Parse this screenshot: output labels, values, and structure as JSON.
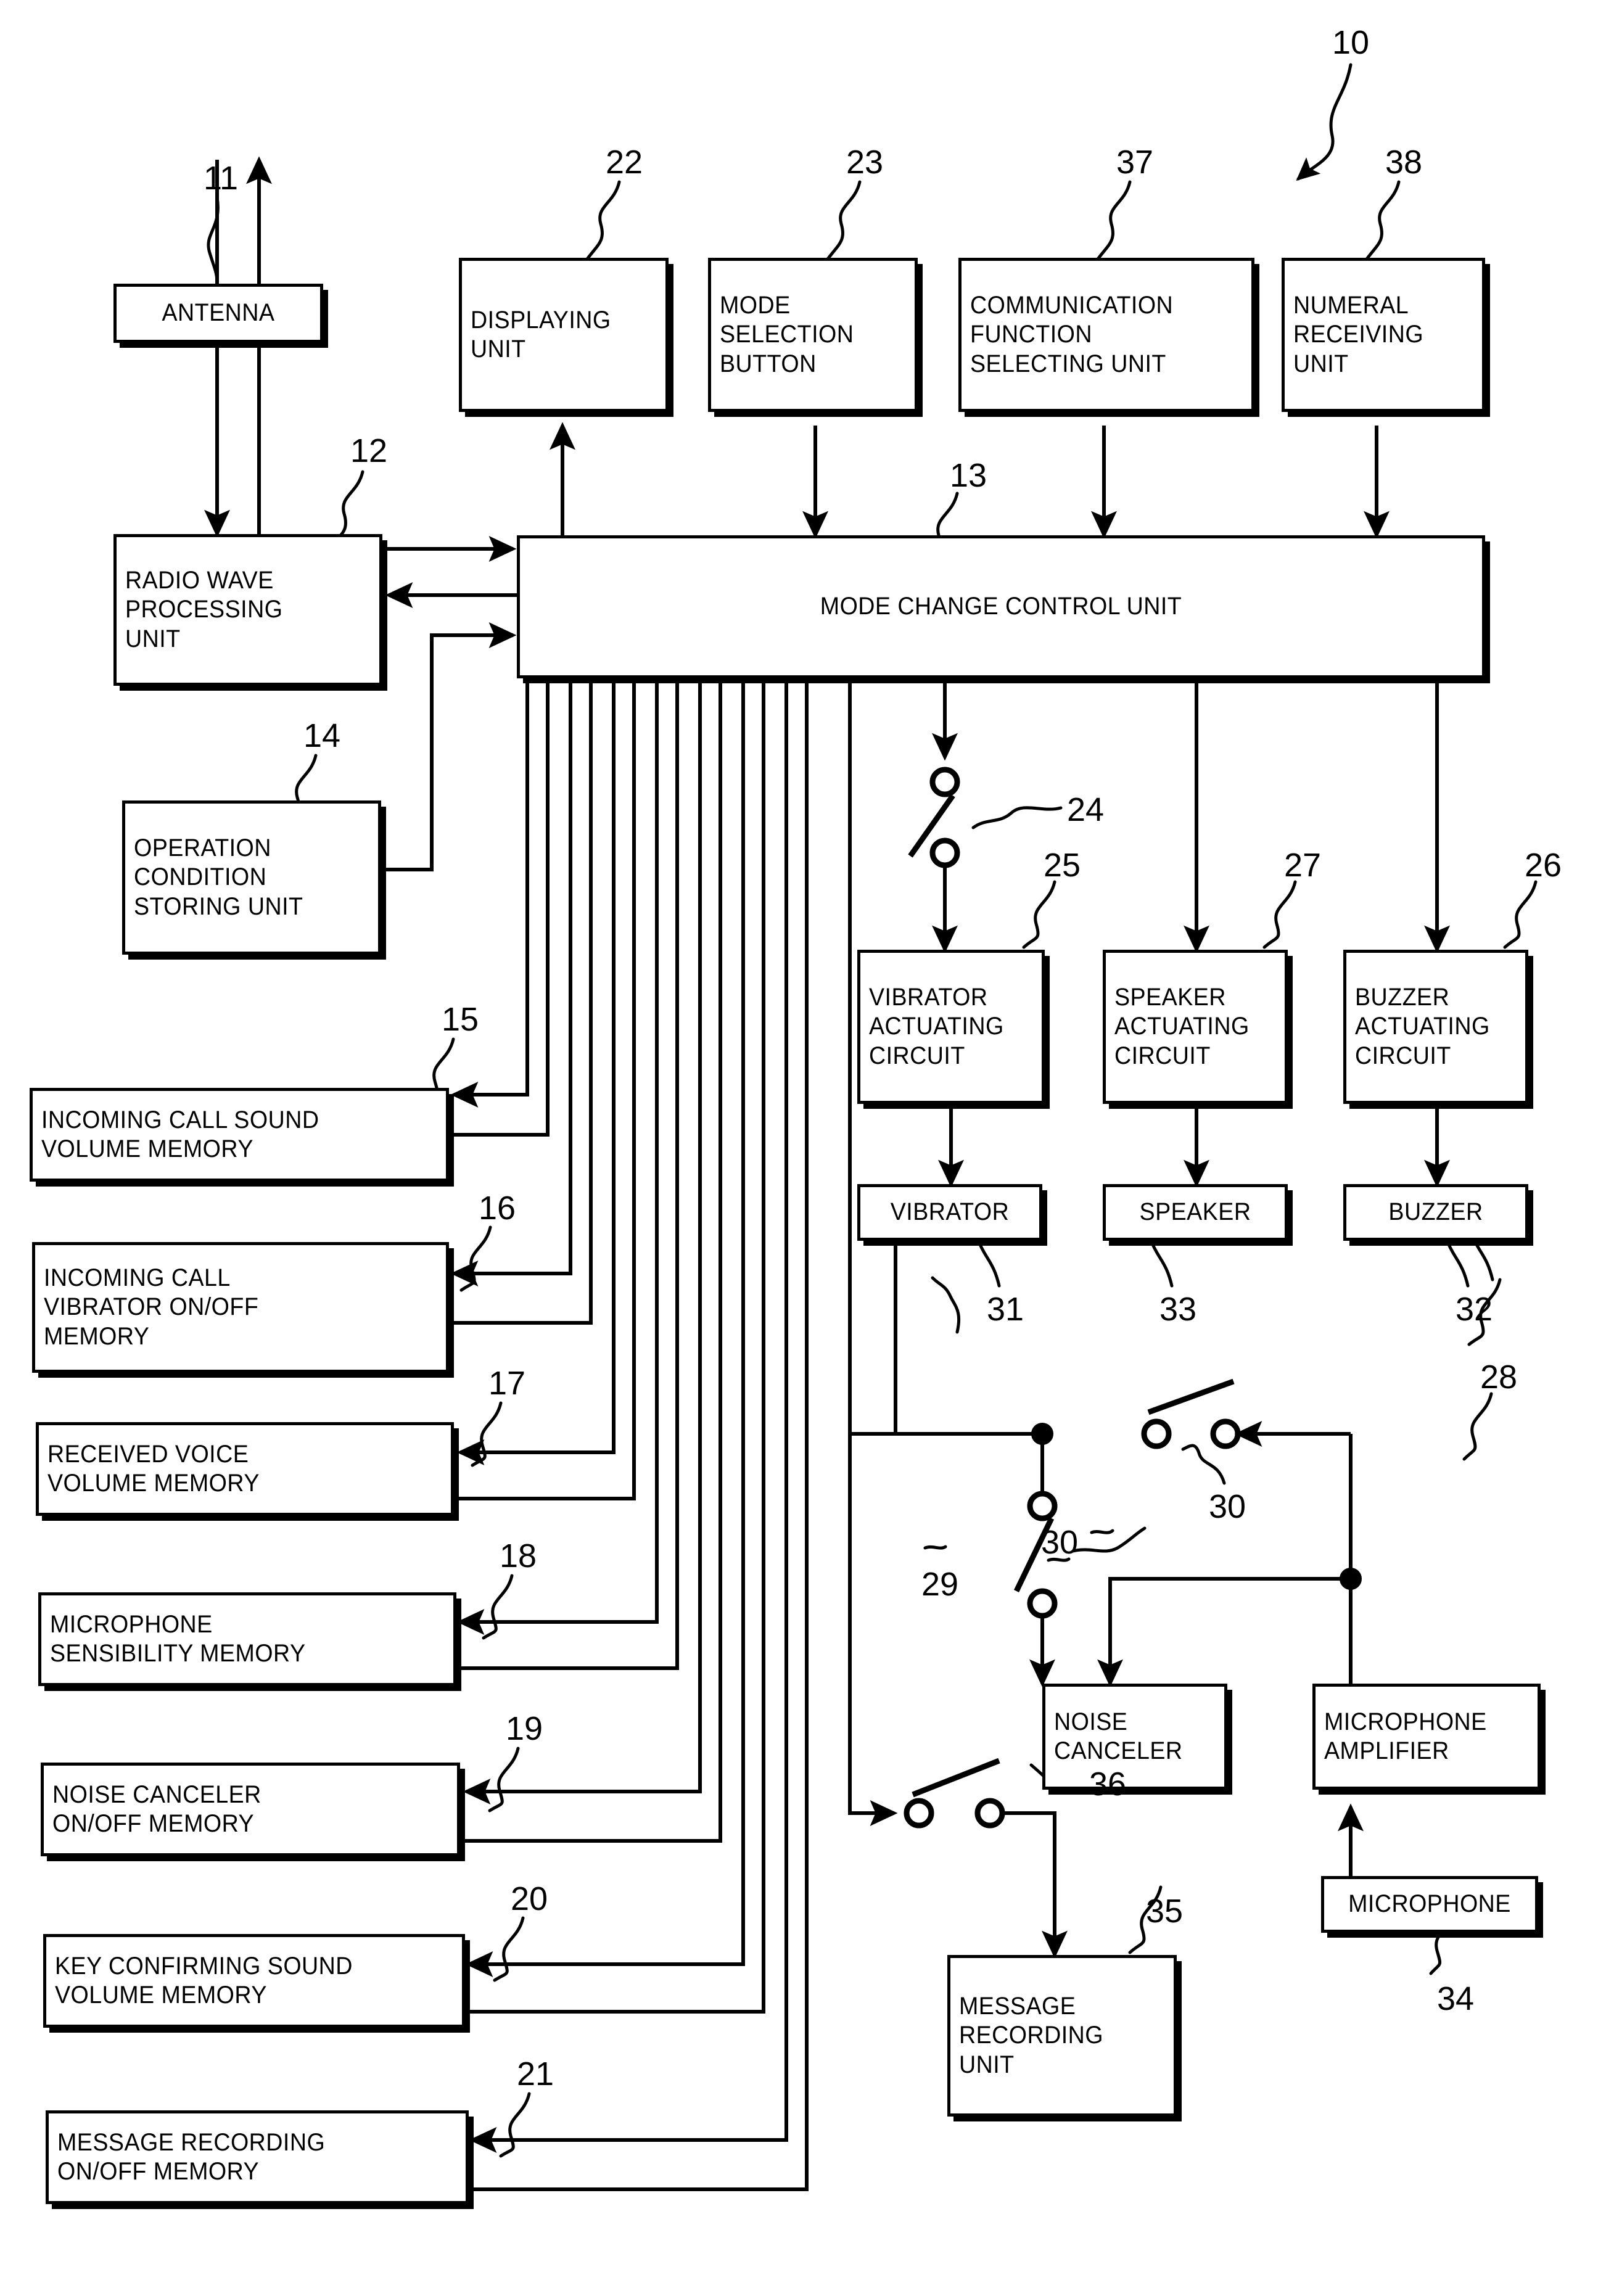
{
  "figure": {
    "system_ref": "10",
    "blocks": [
      {
        "id": "antenna",
        "ref": "11",
        "lines": [
          "ANTENNA"
        ]
      },
      {
        "id": "radio-wave",
        "ref": "12",
        "lines": [
          "RADIO WAVE",
          "PROCESSING",
          "UNIT"
        ]
      },
      {
        "id": "mode-control",
        "ref": "13",
        "lines": [
          "MODE CHANGE CONTROL UNIT"
        ]
      },
      {
        "id": "op-condition",
        "ref": "14",
        "lines": [
          "OPERATION",
          "CONDITION",
          "STORING UNIT"
        ]
      },
      {
        "id": "mem-call-sound",
        "ref": "15",
        "lines": [
          "INCOMING CALL SOUND",
          "VOLUME MEMORY"
        ]
      },
      {
        "id": "mem-call-vib",
        "ref": "16",
        "lines": [
          "INCOMING CALL",
          "VIBRATOR ON/OFF",
          "MEMORY"
        ]
      },
      {
        "id": "mem-rx-voice",
        "ref": "17",
        "lines": [
          "RECEIVED VOICE",
          "VOLUME MEMORY"
        ]
      },
      {
        "id": "mem-mic-sens",
        "ref": "18",
        "lines": [
          "MICROPHONE",
          "SENSIBILITY MEMORY"
        ]
      },
      {
        "id": "mem-noise",
        "ref": "19",
        "lines": [
          "NOISE CANCELER",
          "ON/OFF MEMORY"
        ]
      },
      {
        "id": "mem-key-sound",
        "ref": "20",
        "lines": [
          "KEY CONFIRMING SOUND",
          "VOLUME MEMORY"
        ]
      },
      {
        "id": "mem-msg-rec",
        "ref": "21",
        "lines": [
          "MESSAGE RECORDING",
          "ON/OFF MEMORY"
        ]
      },
      {
        "id": "display",
        "ref": "22",
        "lines": [
          "DISPLAYING",
          "UNIT"
        ]
      },
      {
        "id": "mode-button",
        "ref": "23",
        "lines": [
          "MODE",
          "SELECTION",
          "BUTTON"
        ]
      },
      {
        "id": "switch-24",
        "ref": "24",
        "lines": []
      },
      {
        "id": "vib-actuating",
        "ref": "25",
        "lines": [
          "VIBRATOR",
          "ACTUATING",
          "CIRCUIT"
        ]
      },
      {
        "id": "buz-actuating",
        "ref": "26",
        "lines": [
          "BUZZER",
          "ACTUATING",
          "CIRCUIT"
        ]
      },
      {
        "id": "spk-actuating",
        "ref": "27",
        "lines": [
          "SPEAKER",
          "ACTUATING",
          "CIRCUIT"
        ]
      },
      {
        "id": "mic-amp",
        "ref": "28",
        "lines": [
          "MICROPHONE",
          "AMPLIFIER"
        ]
      },
      {
        "id": "noise-canceler",
        "ref": "29",
        "lines": [
          "NOISE",
          "CANCELER"
        ]
      },
      {
        "id": "switch-30",
        "ref": "30",
        "lines": []
      },
      {
        "id": "vibrator",
        "ref": "31",
        "lines": [
          "VIBRATOR"
        ]
      },
      {
        "id": "buzzer",
        "ref": "32",
        "lines": [
          "BUZZER"
        ]
      },
      {
        "id": "speaker",
        "ref": "33",
        "lines": [
          "SPEAKER"
        ]
      },
      {
        "id": "microphone",
        "ref": "34",
        "lines": [
          "MICROPHONE"
        ]
      },
      {
        "id": "msg-rec-unit",
        "ref": "35",
        "lines": [
          "MESSAGE",
          "RECORDING",
          "UNIT"
        ]
      },
      {
        "id": "switch-36",
        "ref": "36",
        "lines": []
      },
      {
        "id": "comm-func",
        "ref": "37",
        "lines": [
          "COMMUNICATION",
          "FUNCTION",
          "SELECTING UNIT"
        ]
      },
      {
        "id": "numeral-rx",
        "ref": "38",
        "lines": [
          "NUMERAL",
          "RECEIVING",
          "UNIT"
        ]
      }
    ],
    "refs": {
      "r10": "10",
      "r11": "11",
      "r12": "12",
      "r13": "13",
      "r14": "14",
      "r15": "15",
      "r16": "16",
      "r17": "17",
      "r18": "18",
      "r19": "19",
      "r20": "20",
      "r21": "21",
      "r22": "22",
      "r23": "23",
      "r24": "24",
      "r25": "25",
      "r26": "26",
      "r27": "27",
      "r28": "28",
      "r29": "29",
      "r30a": "30",
      "r30b": "30",
      "r31": "31",
      "r32": "32",
      "r33": "33",
      "r34": "34",
      "r35": "35",
      "r36": "36",
      "r37": "37",
      "r38": "38"
    },
    "labels": {
      "antenna_l1": "ANTENNA",
      "radio_l1": "RADIO WAVE",
      "radio_l2": "PROCESSING",
      "radio_l3": "UNIT",
      "mode_control_l1": "MODE CHANGE CONTROL UNIT",
      "opcond_l1": "OPERATION",
      "opcond_l2": "CONDITION",
      "opcond_l3": "STORING UNIT",
      "m15_l1": "INCOMING CALL SOUND",
      "m15_l2": "VOLUME MEMORY",
      "m16_l1": "INCOMING CALL",
      "m16_l2": "VIBRATOR ON/OFF",
      "m16_l3": "MEMORY",
      "m17_l1": "RECEIVED VOICE",
      "m17_l2": "VOLUME MEMORY",
      "m18_l1": "MICROPHONE",
      "m18_l2": "SENSIBILITY MEMORY",
      "m19_l1": "NOISE CANCELER",
      "m19_l2": "ON/OFF MEMORY",
      "m20_l1": "KEY CONFIRMING SOUND",
      "m20_l2": "VOLUME MEMORY",
      "m21_l1": "MESSAGE RECORDING",
      "m21_l2": "ON/OFF MEMORY",
      "disp_l1": "DISPLAYING",
      "disp_l2": "UNIT",
      "btn_l1": "MODE",
      "btn_l2": "SELECTION",
      "btn_l3": "BUTTON",
      "comm_l1": "COMMUNICATION",
      "comm_l2": "FUNCTION",
      "comm_l3": "SELECTING UNIT",
      "num_l1": "NUMERAL",
      "num_l2": "RECEIVING",
      "num_l3": "UNIT",
      "vibc_l1": "VIBRATOR",
      "vibc_l2": "ACTUATING",
      "vibc_l3": "CIRCUIT",
      "spkc_l1": "SPEAKER",
      "spkc_l2": "ACTUATING",
      "spkc_l3": "CIRCUIT",
      "buzc_l1": "BUZZER",
      "buzc_l2": "ACTUATING",
      "buzc_l3": "CIRCUIT",
      "vib_l1": "VIBRATOR",
      "spk_l1": "SPEAKER",
      "buz_l1": "BUZZER",
      "nc_l1": "NOISE",
      "nc_l2": "CANCELER",
      "micamp_l1": "MICROPHONE",
      "micamp_l2": "AMPLIFIER",
      "mic_l1": "MICROPHONE",
      "mru_l1": "MESSAGE",
      "mru_l2": "RECORDING",
      "mru_l3": "UNIT"
    }
  }
}
